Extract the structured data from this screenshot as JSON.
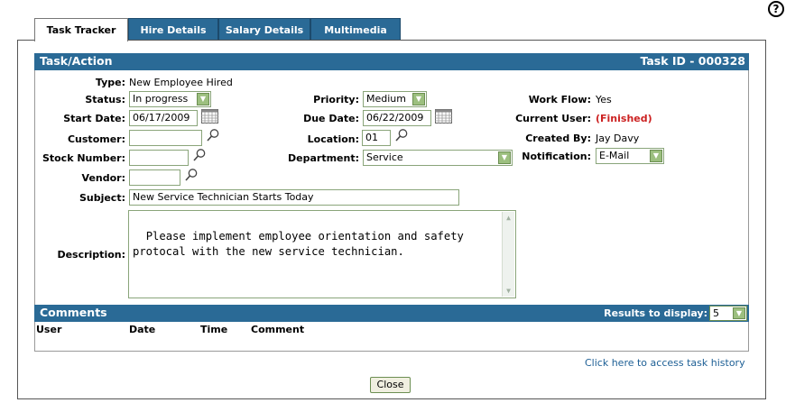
{
  "help": {
    "glyph": "?"
  },
  "tabs": [
    {
      "label": "Task Tracker"
    },
    {
      "label": "Hire Details"
    },
    {
      "label": "Salary Details"
    },
    {
      "label": "Multimedia"
    }
  ],
  "task": {
    "section_title": "Task/Action",
    "task_id": "Task ID - 000328",
    "type_label": "Type:",
    "type_value": "New Employee Hired",
    "status_label": "Status:",
    "status_value": "In progress",
    "start_date_label": "Start Date:",
    "start_date_value": "06/17/2009",
    "customer_label": "Customer:",
    "customer_value": "",
    "stock_number_label": "Stock Number:",
    "stock_number_value": "",
    "vendor_label": "Vendor:",
    "vendor_value": "",
    "subject_label": "Subject:",
    "subject_value": "New Service Technician Starts Today",
    "description_label": "Description:",
    "description_value": "Please implement employee orientation and safety\nprotocal with the new service technician.",
    "priority_label": "Priority:",
    "priority_value": "Medium",
    "due_date_label": "Due Date:",
    "due_date_value": "06/22/2009",
    "location_label": "Location:",
    "location_value": "01",
    "department_label": "Department:",
    "department_value": "Service",
    "workflow_label": "Work Flow:",
    "workflow_value": "Yes",
    "current_user_label": "Current User:",
    "current_user_value": "(Finished)",
    "created_by_label": "Created By:",
    "created_by_value": "Jay Davy",
    "notification_label": "Notification:",
    "notification_value": "E-Mail"
  },
  "comments": {
    "section_title": "Comments",
    "results_label": "Results to display:",
    "results_value": "5",
    "columns": [
      "User",
      "Date",
      "Time",
      "Comment"
    ]
  },
  "footer": {
    "history_link": "Click here to access task history",
    "close_button": "Close"
  },
  "colors": {
    "header_blue": "#2a6a96",
    "link_blue": "#1d5f95",
    "finished_red": "#cc2222",
    "dropdown_green": "#9cbf7f"
  }
}
